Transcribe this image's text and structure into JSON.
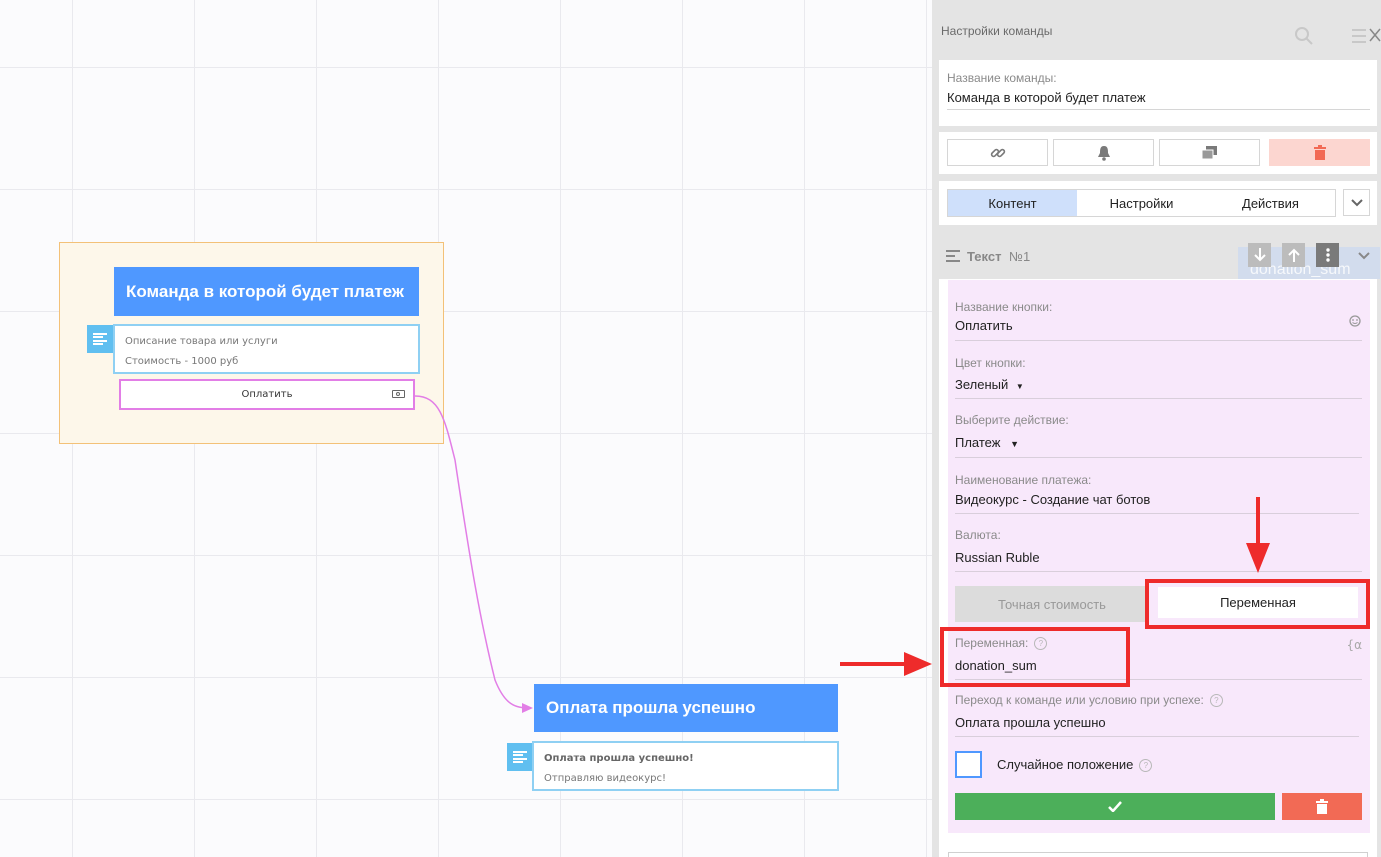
{
  "canvas": {
    "command1": {
      "title": "Команда в которой будет платеж",
      "message_line1": "Описание товара или услуги",
      "message_line2": "Стоимость - 1000 руб",
      "button_label": "Оплатить"
    },
    "command2": {
      "title": "Оплата прошла успешно",
      "message_line1": "Оплата прошла успешно!",
      "message_line2": "Отправляю видеокурс!"
    }
  },
  "panel": {
    "title": "Настройки команды",
    "name_label": "Название команды:",
    "name_value": "Команда в которой будет платеж",
    "tabs": [
      {
        "label": "Контент",
        "active": true
      },
      {
        "label": "Настройки",
        "active": false
      },
      {
        "label": "Действия",
        "active": false
      }
    ],
    "section_title": "Текст",
    "section_number": "№1",
    "overlay_text": "donation_sum",
    "fields": {
      "button_name_label": "Название кнопки:",
      "button_name_value": "Оплатить",
      "button_color_label": "Цвет кнопки:",
      "button_color_value": "Зеленый",
      "action_label": "Выберите действие:",
      "action_value": "Платеж",
      "payment_name_label": "Наименование платежа:",
      "payment_name_value": "Видеокурс - Создание чат ботов",
      "currency_label": "Валюта:",
      "currency_value": "Russian Ruble",
      "exact_price_label": "Точная стоимость",
      "variable_toggle_label": "Переменная",
      "variable_label": "Переменная:",
      "variable_value": "donation_sum",
      "success_label": "Переход к команде или условию при успехе:",
      "success_value": "Оплата прошла успешно",
      "random_label": "Случайное положение"
    },
    "help_glyph": "?",
    "colors": {
      "accent_blue": "#4f98ff",
      "confirm_green": "#4caf5a",
      "delete_red": "#f26a55",
      "highlight_red": "#ee2b2b"
    }
  }
}
